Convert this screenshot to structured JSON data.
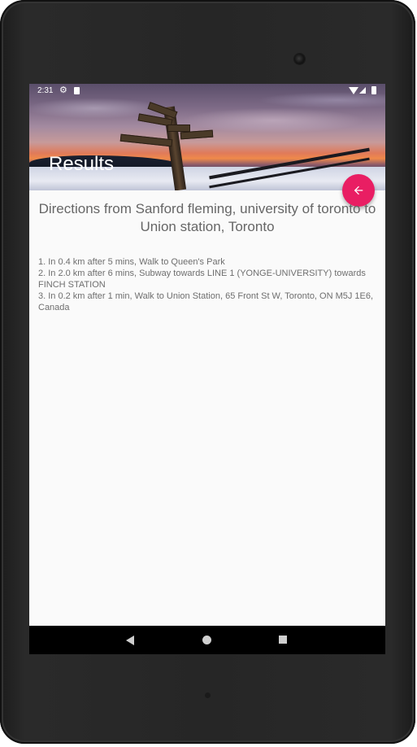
{
  "status_bar": {
    "time": "2:31",
    "icons": [
      "gear-icon",
      "sd-card-icon",
      "wifi-icon",
      "signal-icon",
      "battery-icon"
    ]
  },
  "header": {
    "title": "Results",
    "background_image": "signpost-sunset-snow-image"
  },
  "fab": {
    "icon": "arrow-back-icon",
    "color": "#e91e63"
  },
  "directions": {
    "heading": "Directions from Sanford fleming, university of toronto to Union station, Toronto",
    "steps": [
      "1. In 0.4 km after 5 mins, Walk to Queen's Park",
      "2. In 2.0 km after 6 mins, Subway towards LINE 1 (YONGE-UNIVERSITY) towards FINCH STATION",
      "3. In 0.2 km after 1 min, Walk to Union Station, 65 Front St W, Toronto, ON M5J 1E6, Canada"
    ]
  },
  "nav_bar": {
    "buttons": [
      "back-icon",
      "home-icon",
      "recents-icon"
    ]
  }
}
